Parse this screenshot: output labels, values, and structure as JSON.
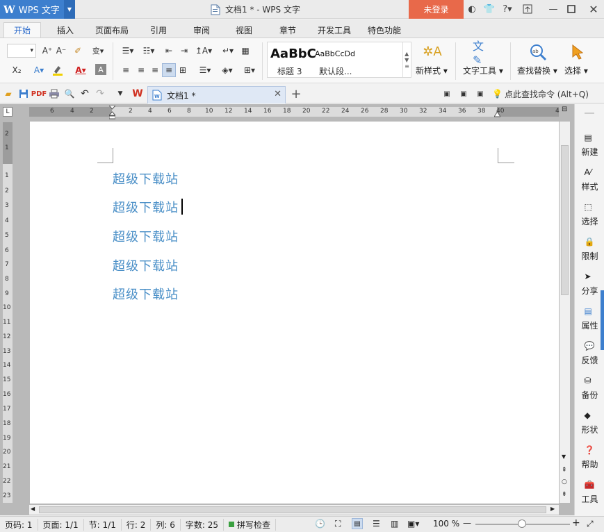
{
  "app": {
    "name": "WPS 文字",
    "logo": "W"
  },
  "window": {
    "title": "文档1 * - WPS 文字",
    "login_label": "未登录"
  },
  "menu_tabs": [
    "开始",
    "插入",
    "页面布局",
    "引用",
    "审阅",
    "视图",
    "章节",
    "开发工具",
    "特色功能"
  ],
  "ribbon": {
    "style_preview_1": "AaBbC",
    "style_preview_2": "AaBbCcDd",
    "style_name_1": "标题 3",
    "style_name_2": "默认段...",
    "new_style": "新样式",
    "text_tools": "文字工具",
    "find_replace": "查找替换",
    "select": "选择"
  },
  "doc_tab": {
    "label": "文档1 *"
  },
  "find_command": "点此查找命令 (Alt+Q)",
  "document": {
    "lines": [
      "超级下载站",
      "超级下载站",
      "超级下载站",
      "超级下载站",
      "超级下载站"
    ]
  },
  "ruler_h": [
    "6",
    "4",
    "2",
    "2",
    "4",
    "6",
    "8",
    "10",
    "12",
    "14",
    "16",
    "18",
    "20",
    "22",
    "24",
    "26",
    "28",
    "30",
    "32",
    "34",
    "36",
    "38",
    "40",
    "4"
  ],
  "ruler_v": [
    "2",
    "1",
    "1",
    "2",
    "3",
    "4",
    "5",
    "6",
    "7",
    "8",
    "9",
    "10",
    "11",
    "12",
    "13",
    "14",
    "15",
    "16",
    "17",
    "18",
    "19",
    "20",
    "21",
    "22",
    "23"
  ],
  "side_panel": [
    "新建",
    "样式",
    "选择",
    "限制",
    "分享",
    "属性",
    "反馈",
    "备份",
    "形状",
    "帮助",
    "工具"
  ],
  "status": {
    "page": "页码: 1",
    "pages": "页面: 1/1",
    "section": "节: 1/1",
    "row": "行: 2",
    "col": "列: 6",
    "words": "字数: 25",
    "spellcheck": "拼写检查",
    "zoom": "100 %"
  },
  "colors": {
    "accent": "#3d7fce",
    "login": "#e8694a",
    "doc_text": "#4a8fc7"
  }
}
